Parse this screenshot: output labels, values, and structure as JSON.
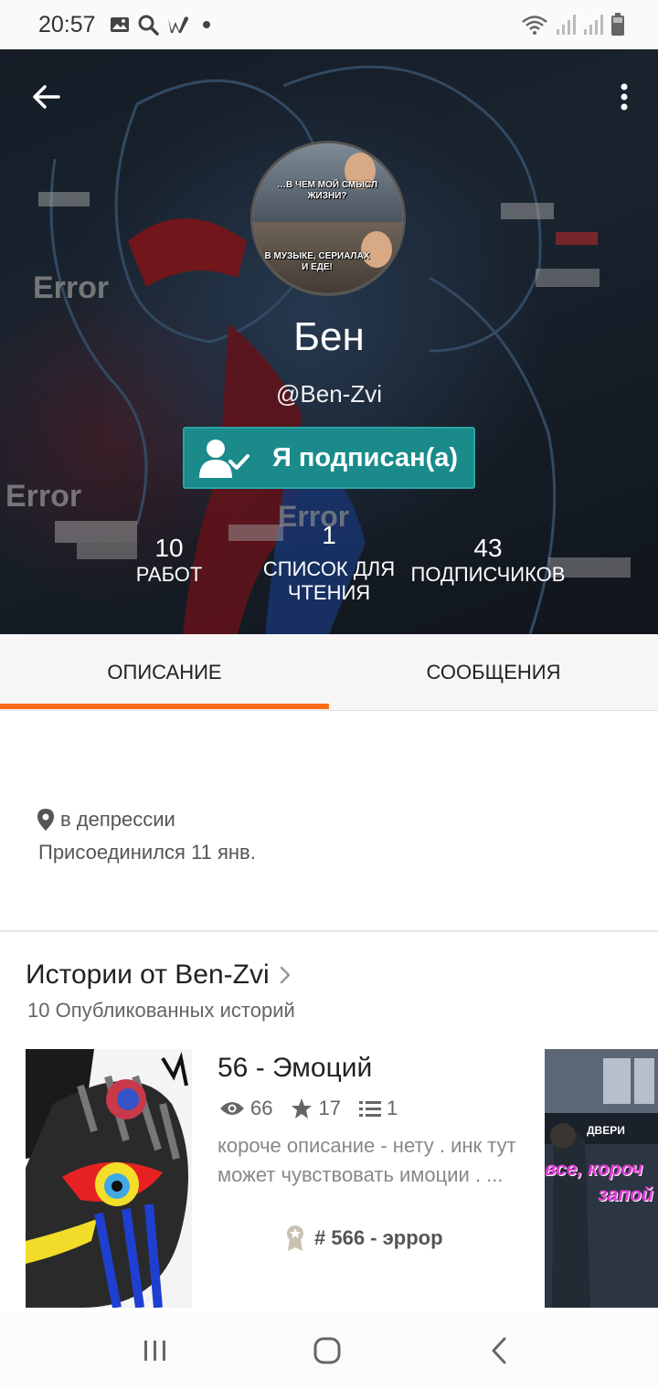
{
  "status_bar": {
    "time": "20:57",
    "left_icons": [
      "gallery-icon",
      "search-icon",
      "wattpad-icon",
      "dot-icon"
    ],
    "right_icons": [
      "wifi-icon",
      "signal-icon",
      "signal-icon",
      "battery-icon"
    ]
  },
  "header": {
    "back_icon": "arrow-left-icon",
    "menu_icon": "more-vert-icon",
    "avatar_captions": {
      "top": "…В ЧЕМ МОЙ СМЫСЛ ЖИЗНИ?",
      "bottom": "В МУЗЫКЕ, СЕРИАЛАХ И ЕДЕ!"
    },
    "background_texts": [
      "Error",
      "Error",
      "Error"
    ],
    "name": "Бен",
    "handle": "@Ben-Zvi",
    "follow_button": {
      "label": "Я подписан(а)",
      "icon": "user-check-icon",
      "color": "#1a8a8a"
    },
    "stats": [
      {
        "value": "10",
        "label": "РАБОТ"
      },
      {
        "value": "1",
        "label_line1": "СПИСОК ДЛЯ",
        "label_line2": "ЧТЕНИЯ"
      },
      {
        "value": "43",
        "label": "ПОДПИСЧИКОВ"
      }
    ]
  },
  "tabs": {
    "items": [
      {
        "label": "ОПИСАНИЕ",
        "active": true
      },
      {
        "label": "СООБЩЕНИЯ",
        "active": false
      }
    ],
    "accent_color": "#ff6a1a"
  },
  "about": {
    "location_icon": "location-pin-icon",
    "location": "в депрессии",
    "joined": "Присоединился 11 янв."
  },
  "stories": {
    "title": "Истории от Ben-Zvi",
    "subtitle": "10 Опубликованных историй",
    "items": [
      {
        "title": "56 - Эмоций",
        "views": "66",
        "votes": "17",
        "parts": "1",
        "description": "короче описание - нету . инк тут может чувствовать имоции . ...",
        "rank": "# 566 - эррор"
      },
      {
        "cover_text_1": "все, короч",
        "cover_text_2": "запой",
        "cover_sign": "ДВЕРИ"
      }
    ]
  },
  "nav_bar": {
    "recent_icon": "recents-icon",
    "home_icon": "home-icon",
    "back_icon": "back-chevron-icon"
  }
}
